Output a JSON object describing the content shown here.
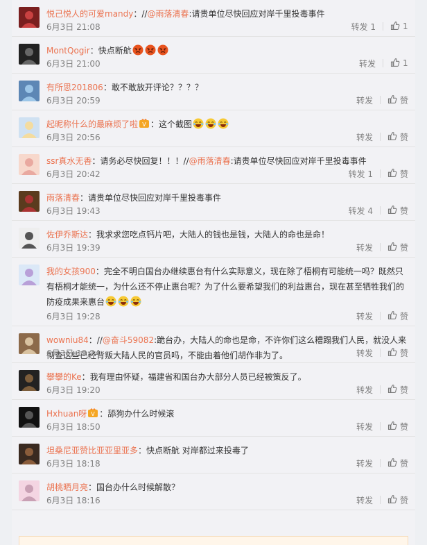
{
  "comments": [
    {
      "user": "悦己悦人的可爱mandy",
      "segments": [
        {
          "t": "//"
        },
        {
          "t": "@雨落清春",
          "m": true
        },
        {
          "t": ":请贵单位尽快回应对岸千里投毒事件"
        }
      ],
      "time": "6月3日 21:08",
      "repost": "转发 1",
      "like_count": "1",
      "avatar": "a1"
    },
    {
      "user": "MontQogir",
      "segments": [
        {
          "t": "快点断航"
        }
      ],
      "emoji": [
        "angry",
        "angry",
        "angry"
      ],
      "time": "6月3日 21:00",
      "repost": "转发",
      "like_count": "1",
      "avatar": "a2"
    },
    {
      "user": "有所思201806",
      "segments": [
        {
          "t": "敢不敢放开评论？？？？"
        }
      ],
      "time": "6月3日 20:59",
      "repost": "转发",
      "like_count": "赞",
      "avatar": "a3"
    },
    {
      "user": "起昵称什么的最麻烦了啦",
      "badge": true,
      "segments": [
        {
          "t": "这个截图"
        }
      ],
      "emoji": [
        "laugh",
        "laugh",
        "laugh"
      ],
      "time": "6月3日 20:56",
      "repost": "转发",
      "like_count": "赞",
      "avatar": "a4"
    },
    {
      "user": "ssr真水无香",
      "segments": [
        {
          "t": "请务必尽快回复！！！//"
        },
        {
          "t": "@雨落清春",
          "m": true
        },
        {
          "t": ":请贵单位尽快回应对岸千里投毒事件"
        }
      ],
      "time": "6月3日 20:42",
      "repost": "转发 1",
      "like_count": "赞",
      "avatar": "a5"
    },
    {
      "user": "雨落清春",
      "segments": [
        {
          "t": "请贵单位尽快回应对岸千里投毒事件"
        }
      ],
      "time": "6月3日 19:43",
      "repost": "转发 4",
      "like_count": "赞",
      "avatar": "a6"
    },
    {
      "user": "佐伊乔斯达",
      "segments": [
        {
          "t": "我求求您吃点钙片吧，大陆人的钱也是钱，大陆人的命也是命！"
        }
      ],
      "time": "6月3日 19:39",
      "repost": "转发",
      "like_count": "赞",
      "avatar": "a7"
    },
    {
      "user": "我的女孩900",
      "segments": [
        {
          "t": "完全不明白国台办继续惠台有什么实际意义，现在除了梧桐有可能统一吗？既然只有梧桐才能统一，为什么还不停止惠台呢？为了什么要希望我们的利益惠台，现在甚至牺牲我们的防疫成果来惠台"
        }
      ],
      "emoji": [
        "laugh",
        "laugh",
        "laugh"
      ],
      "time": "6月3日 19:28",
      "repost": "转发",
      "like_count": "赞",
      "avatar": "a8"
    },
    {
      "user": "wowniu84",
      "segments": [
        {
          "t": "//"
        },
        {
          "t": "@奋斗59082",
          "m": true
        },
        {
          "t": ":跪台办，大陆人的命也是命，不许你们这么糟蹋我们人民，就没人来彻查这些已经背叛大陆人民的官员吗，不能由着他们胡作非为了。"
        }
      ],
      "time": "6月3日 19:24",
      "repost": "转发",
      "like_count": "赞",
      "avatar": "a9"
    },
    {
      "user": "攀攀的Ke",
      "segments": [
        {
          "t": "我有理由怀疑，福建省和国台办大部分人员已经被策反了。"
        }
      ],
      "time": "6月3日 19:20",
      "repost": "转发",
      "like_count": "赞",
      "avatar": "a10"
    },
    {
      "user": "Hxhuan呀",
      "badge": true,
      "segments": [
        {
          "t": "舔狗办什么时候滚"
        }
      ],
      "time": "6月3日 18:50",
      "repost": "转发",
      "like_count": "赞",
      "avatar": "a11"
    },
    {
      "user": "坦桑尼亚赞比亚亚里亚多",
      "segments": [
        {
          "t": "快点断航  对岸都过来投毒了"
        }
      ],
      "time": "6月3日 18:18",
      "repost": "转发",
      "like_count": "赞",
      "avatar": "a12"
    },
    {
      "user": "胡桃晒月亮",
      "segments": [
        {
          "t": "国台办什么时候解散？"
        }
      ],
      "time": "6月3日 18:16",
      "repost": "转发",
      "like_count": "赞",
      "avatar": "a13"
    }
  ],
  "colors": {
    "accent": "#eb7350",
    "muted": "#808080",
    "panel": "#f2f2f5"
  },
  "like_icon_name": "thumbs-up-icon"
}
